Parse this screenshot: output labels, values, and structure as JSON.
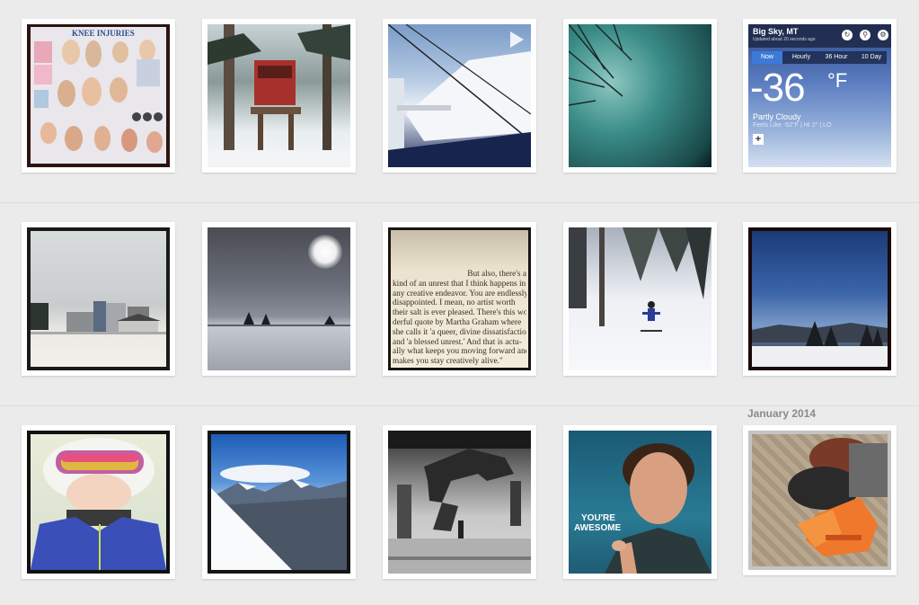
{
  "grid": {
    "section_label": "January 2014",
    "photos": [
      {
        "id": "knee-injuries-chart",
        "caption": "KNEE INJURIES"
      },
      {
        "id": "tree-stand"
      },
      {
        "id": "ski-lift-video"
      },
      {
        "id": "teal-sky-trees"
      },
      {
        "id": "weather-screenshot"
      },
      {
        "id": "industrial-building-snow"
      },
      {
        "id": "sun-over-snowfield"
      },
      {
        "id": "book-quote"
      },
      {
        "id": "skier-in-trees"
      },
      {
        "id": "winter-night-sky"
      },
      {
        "id": "goggles-selfie"
      },
      {
        "id": "mountain-range"
      },
      {
        "id": "dinosaur-skeleton"
      },
      {
        "id": "youre-awesome-meme",
        "caption_line1": "YOU'RE",
        "caption_line2": "AWESOME"
      },
      {
        "id": "ski-boots-airport"
      }
    ]
  },
  "weather": {
    "location": "Big Sky, MT",
    "updated": "Updated about 20 seconds ago",
    "tabs": [
      "Now",
      "Hourly",
      "36 Hour",
      "10 Day"
    ],
    "temperature": "-36",
    "unit": "°F",
    "condition": "Partly Cloudy",
    "feels_like": "Feels Like -52°F | HI 2° | LO",
    "add_symbol": "+"
  },
  "book": {
    "lines": [
      "But also, there's a",
      "kind of an unrest that I think happens in",
      "any creative endeavor. You are endlessly",
      "disappointed. I mean, no artist worth",
      "their salt is ever pleased. There's this won-",
      "derful quote by Martha Graham where",
      "she calls it 'a queer, divine dissatisfaction'",
      "and 'a blessed unrest.' And that is actu-",
      "ally what keeps you moving forward and",
      "makes you stay creatively alive.\""
    ]
  },
  "colors": {
    "background": "#ebebeb",
    "tile_frame": "#ffffff",
    "label": "#8a8a8a"
  }
}
